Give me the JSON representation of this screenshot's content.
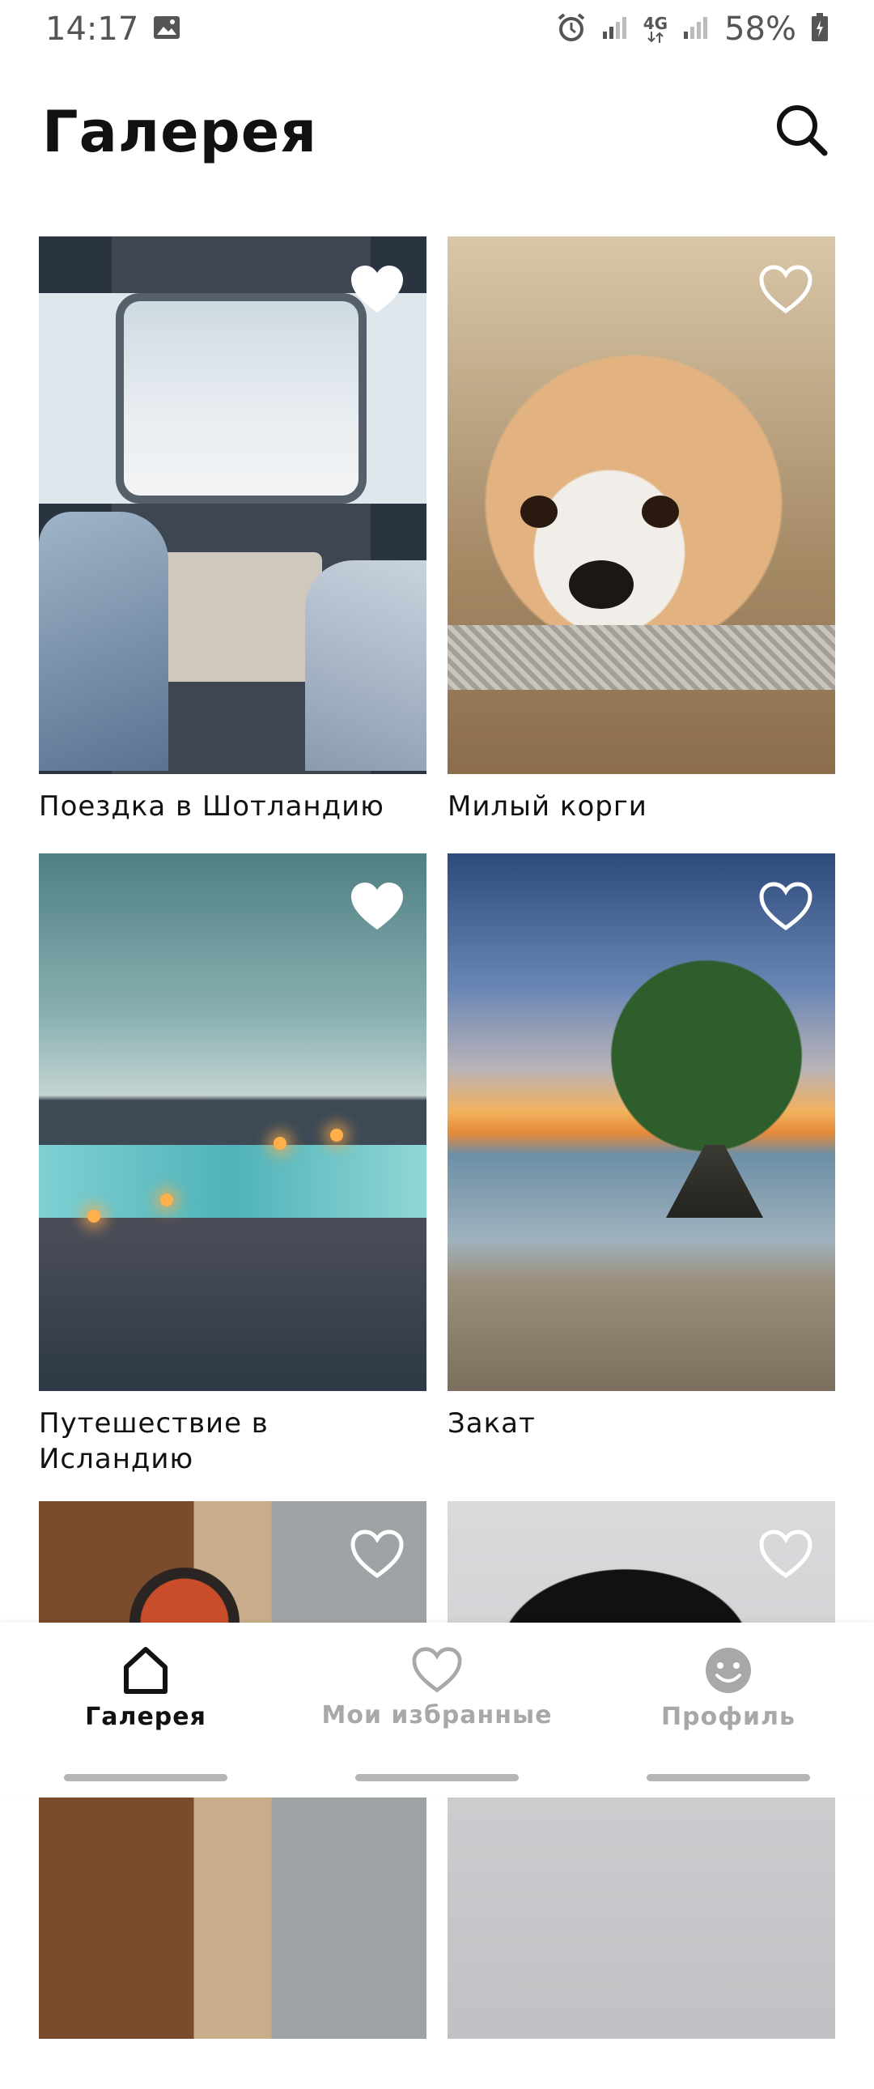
{
  "status_bar": {
    "time": "14:17",
    "network_label": "4G",
    "battery": "58%"
  },
  "header": {
    "title": "Галерея"
  },
  "gallery": {
    "items": [
      {
        "title": "Поездка в Шотландию",
        "favorited": true
      },
      {
        "title": "Милый корги",
        "favorited": false
      },
      {
        "title": "Путешествие в Исландию",
        "favorited": true
      },
      {
        "title": "Закат",
        "favorited": false
      },
      {
        "title": "",
        "favorited": false
      },
      {
        "title": "",
        "favorited": false
      }
    ]
  },
  "bottom_nav": {
    "items": [
      {
        "label": "Галерея",
        "icon": "home-icon",
        "active": true
      },
      {
        "label": "Мои избранные",
        "icon": "heart-icon",
        "active": false
      },
      {
        "label": "Профиль",
        "icon": "smiley-icon",
        "active": false
      }
    ]
  },
  "colors": {
    "active": "#111111",
    "inactive": "#a8a8a8",
    "background": "#ffffff"
  }
}
